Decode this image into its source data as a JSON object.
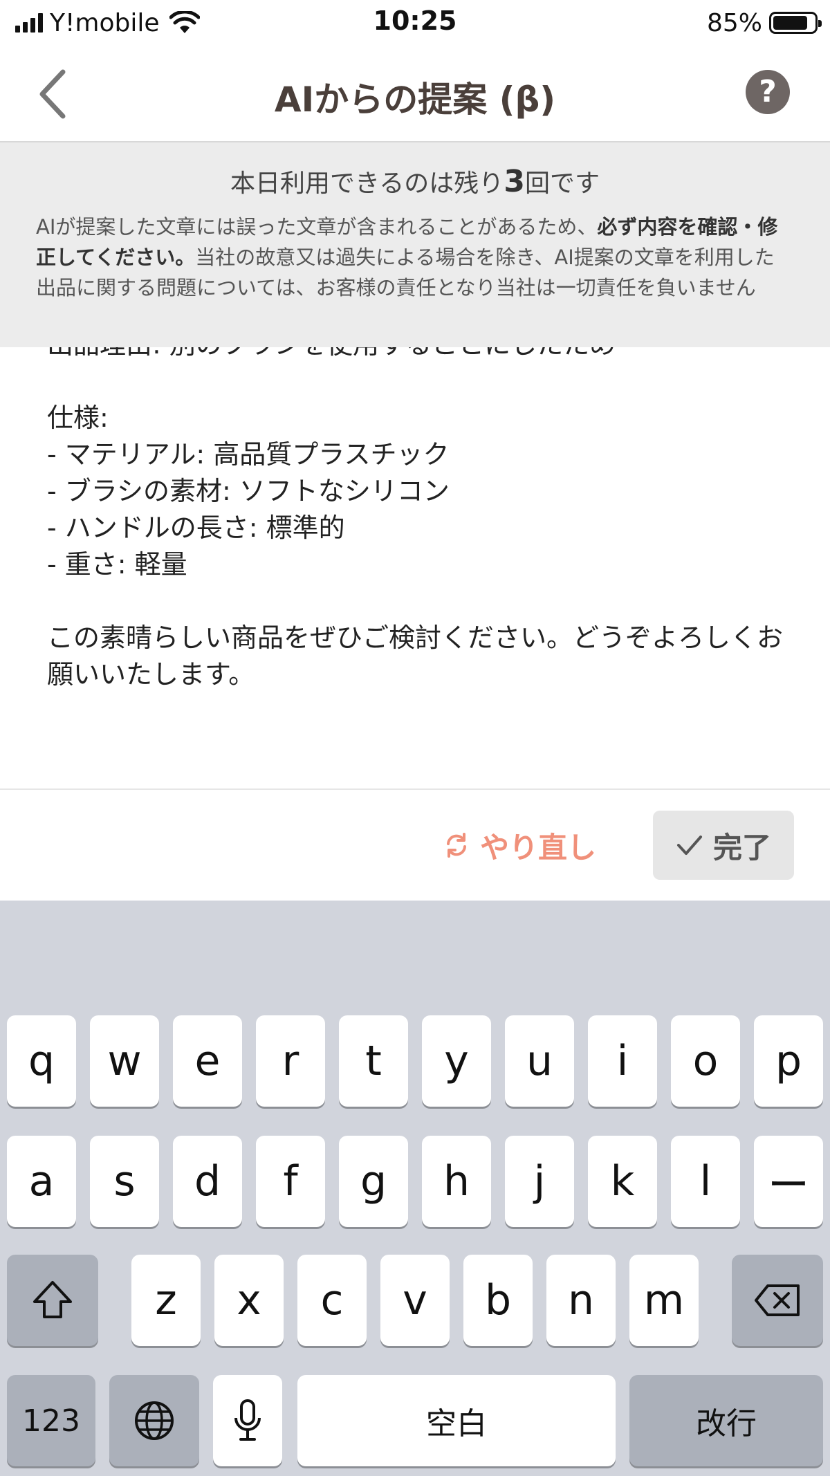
{
  "status_bar": {
    "carrier": "Y!mobile",
    "time": "10:25",
    "battery_percent": "85%",
    "battery_level": 0.85
  },
  "nav": {
    "title": "AIからの提案 (β)",
    "help_label": "?"
  },
  "notice": {
    "remaining_prefix": "本日利用できるのは残り",
    "remaining_count": "3",
    "remaining_suffix": "回です",
    "text_part1": "AIが提案した文章には誤った文章が含まれることがあるため、",
    "text_bold": "必ず内容を確認・修正してください。",
    "text_part2": "当社の故意又は過失による場合を除き、AI提案の文章を利用した出品に関する問題については、お客様の責任となり当社は一切責任を負いません"
  },
  "content": {
    "text": "出品理由: 別のブラシを使用することにしたため\n\n仕様:\n- マテリアル: 高品質プラスチック\n- ブラシの素材: ソフトなシリコン\n- ハンドルの長さ: 標準的\n- 重さ: 軽量\n\nこの素晴らしい商品をぜひご検討ください。どうぞよろしくお願いいたします。"
  },
  "actions": {
    "retry_label": "やり直し",
    "done_label": "完了",
    "accent_color": "#f0907a"
  },
  "keyboard": {
    "row1": [
      "q",
      "w",
      "e",
      "r",
      "t",
      "y",
      "u",
      "i",
      "o",
      "p"
    ],
    "row2": [
      "a",
      "s",
      "d",
      "f",
      "g",
      "h",
      "j",
      "k",
      "l",
      "ー"
    ],
    "row3": [
      "z",
      "x",
      "c",
      "v",
      "b",
      "n",
      "m"
    ],
    "numbers_label": "123",
    "space_label": "空白",
    "return_label": "改行"
  }
}
